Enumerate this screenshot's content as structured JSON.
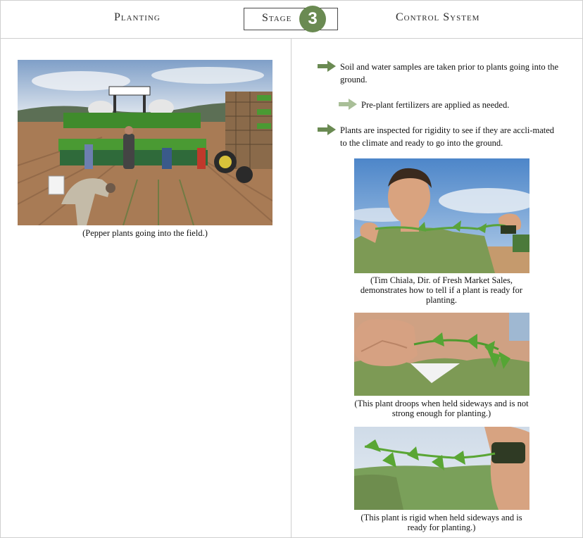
{
  "header": {
    "left_title": "Planting",
    "stage_label": "Stage",
    "stage_number": "3",
    "right_title": "Control System"
  },
  "left": {
    "photo_caption": "(Pepper plants going into the field.)"
  },
  "right": {
    "bullets": [
      {
        "text": "Soil and water samples are taken prior to plants going into the ground.",
        "arrow": "dark-green-arrow-icon"
      },
      {
        "text": "Pre-plant fertilizers are applied as needed.",
        "arrow": "light-green-arrow-icon"
      },
      {
        "text": "Plants are inspected for rigidity to see if they are accli-mated to the climate and ready to go into the ground.",
        "arrow": "dark-green-arrow-icon"
      }
    ],
    "captions": [
      "(Tim Chiala, Dir. of Fresh Market Sales, demonstrates how to tell if a plant is ready for planting.",
      "(This plant droops when held sideways and is not strong enough for planting.)",
      "(This plant is rigid when held sideways and is ready for planting.)"
    ]
  },
  "colors": {
    "accent_green": "#6a8a52",
    "arrow_dark": "#6a8a52",
    "arrow_light": "#a9bf98",
    "border": "#cfcfcf"
  }
}
